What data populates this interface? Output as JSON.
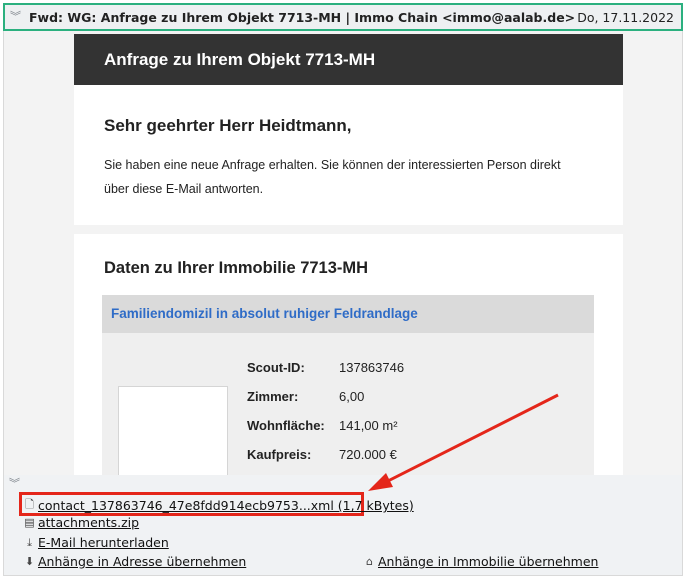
{
  "header": {
    "subject": "Fwd: WG: Anfrage zu Ihrem Objekt 7713-MH | Immo Chain <immo@aalab.de>",
    "date": "Do, 17.11.2022"
  },
  "mail": {
    "banner_title": "Anfrage zu Ihrem Objekt 7713-MH",
    "greeting": "Sehr geehrter Herr Heidtmann,",
    "intro": "Sie haben eine neue Anfrage erhalten. Sie können der interessierten Person direkt über diese E-Mail antworten.",
    "section_title": "Daten zu Ihrer Immobilie 7713-MH",
    "listing_title": "Familiendomizil in absolut ruhiger Feldrandlage",
    "facts": [
      {
        "label": "Scout-ID:",
        "value": "137863746"
      },
      {
        "label": "Zimmer:",
        "value": "6,00"
      },
      {
        "label": "Wohnfläche:",
        "value": "141,00 m²"
      },
      {
        "label": "Kaufpreis:",
        "value": "720.000 €"
      }
    ]
  },
  "footer": {
    "attachment_1": "contact_137863746_47e8fdd914ecb9753...xml (1,7 kBytes)",
    "attachment_2": "attachments.zip",
    "download": "E-Mail herunterladen",
    "to_address": "Anhänge in Adresse übernehmen",
    "to_property": "Anhänge in Immobilie übernehmen"
  },
  "colors": {
    "header_border": "#2bb07f",
    "highlight": "#e4261a",
    "link_blue": "#2f6cc7",
    "banner_bg": "#333333"
  },
  "icons": [
    "chevron-double-down-icon",
    "file-icon",
    "archive-icon",
    "download-icon",
    "house-icon"
  ]
}
